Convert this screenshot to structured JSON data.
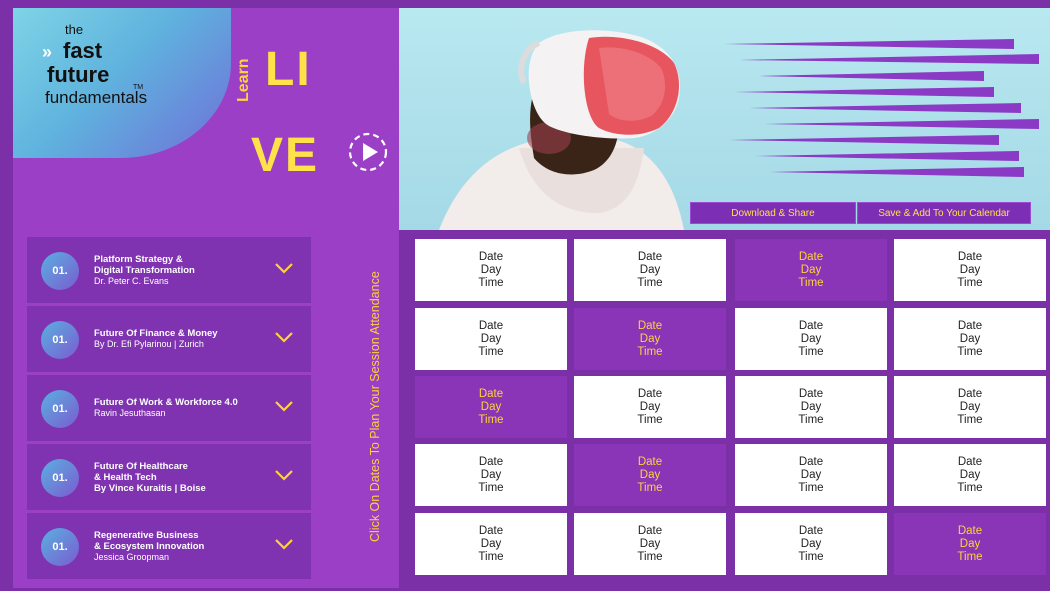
{
  "brand": {
    "the": "the",
    "fast": "fast",
    "future": "future",
    "fundamentals": "fundamentals",
    "tm": "TM"
  },
  "hero_text": {
    "learn": "Learn",
    "li": "LI",
    "ve": "VE"
  },
  "actions": {
    "download": "Download & Share",
    "save": "Save & Add To Your Calendar"
  },
  "cta_vertical": "Click On Dates To Plan Your Session Attendance",
  "sessions": [
    {
      "num": "01.",
      "title1": "Platform Strategy &",
      "title2": "Digital Transformation",
      "sub1": "Dr. Peter C. Evans",
      "sub2": ""
    },
    {
      "num": "01.",
      "title1": "Future Of Finance & Money",
      "title2": "",
      "sub1": "By Dr. Efi Pylarinou | Zurich",
      "sub2": ""
    },
    {
      "num": "01.",
      "title1": "Future Of Work & Workforce 4.0",
      "title2": "",
      "sub1": "Ravin Jesuthasan",
      "sub2": ""
    },
    {
      "num": "01.",
      "title1": "Future Of Healthcare",
      "title2": "& Health Tech",
      "sub1": "By Vince Kuraitis | Boise",
      "sub2": "",
      "sub_bold": true
    },
    {
      "num": "01.",
      "title1": "Regenerative Business",
      "title2": "& Ecosystem Innovation",
      "sub1": "Jessica Groopman",
      "sub2": ""
    }
  ],
  "grid": {
    "labels": [
      "Date",
      "Day",
      "Time"
    ],
    "highlighted": [
      [
        0,
        2
      ],
      [
        1,
        1
      ],
      [
        2,
        0
      ],
      [
        3,
        1
      ],
      [
        4,
        3
      ]
    ]
  },
  "colors": {
    "background": "#7b30a8",
    "panel": "#9a3fc6",
    "accent_yellow": "#ffe14a",
    "cell_white": "#ffffff",
    "cell_purple": "#8a35b8"
  },
  "icons": {
    "play": "play-circle-icon",
    "chevron": "chevron-down-icon",
    "logo_arrow": "double-chevron-right-icon"
  }
}
